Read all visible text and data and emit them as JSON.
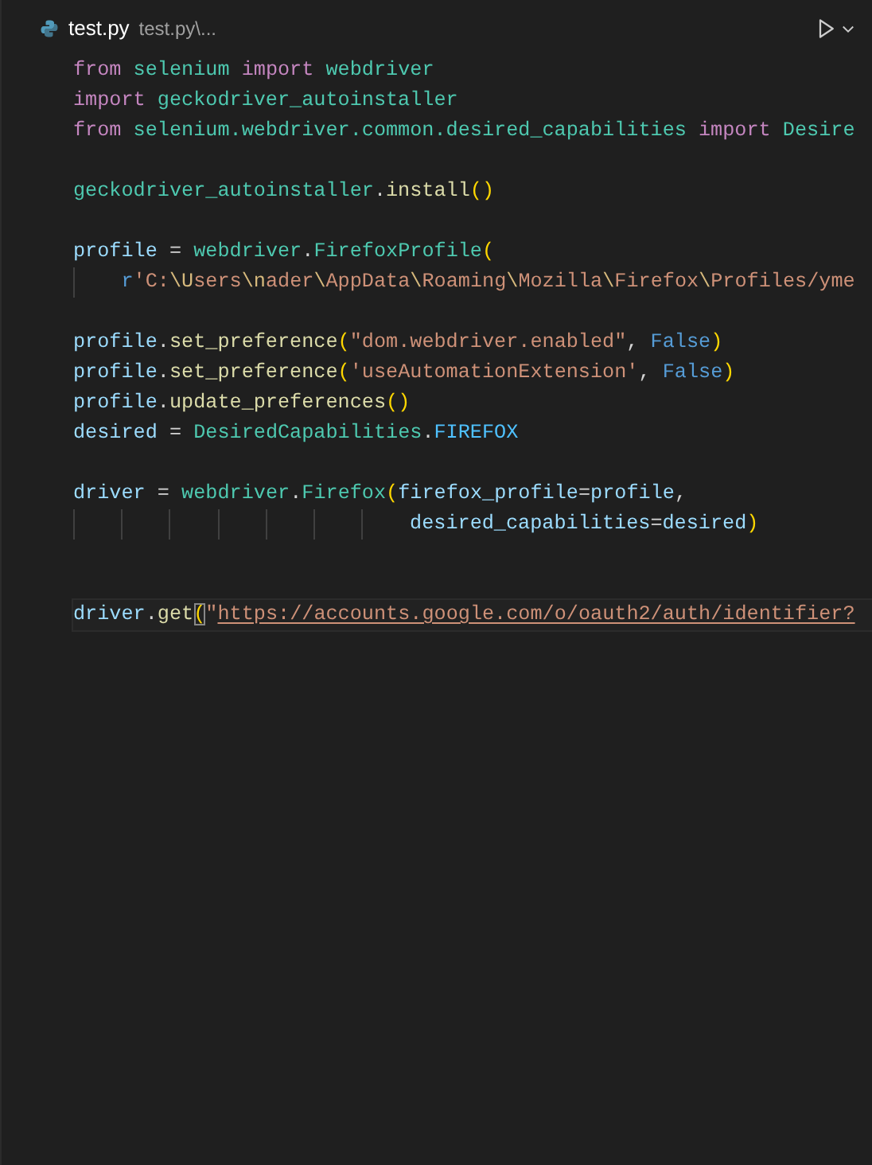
{
  "tab": {
    "title": "test.py",
    "breadcrumb": "test.py\\...",
    "selected": true
  },
  "lines": [
    {
      "kind": "code",
      "tokens": [
        {
          "kind": "kw",
          "text": "from "
        },
        {
          "kind": "mod",
          "text": "selenium "
        },
        {
          "kind": "kw",
          "text": "import "
        },
        {
          "kind": "mod",
          "text": "webdriver"
        }
      ]
    },
    {
      "kind": "code",
      "tokens": [
        {
          "kind": "kw",
          "text": "import "
        },
        {
          "kind": "mod",
          "text": "geckodriver_autoinstaller"
        }
      ]
    },
    {
      "kind": "code",
      "tokens": [
        {
          "kind": "kw",
          "text": "from "
        },
        {
          "kind": "mod",
          "text": "selenium.webdriver.common.desired_capabilities "
        },
        {
          "kind": "kw",
          "text": "import "
        },
        {
          "kind": "mod",
          "text": "Desire"
        }
      ]
    },
    {
      "kind": "blank"
    },
    {
      "kind": "code",
      "tokens": [
        {
          "kind": "mod",
          "text": "geckodriver_autoinstaller"
        },
        {
          "kind": "plain",
          "text": "."
        },
        {
          "kind": "fn",
          "text": "install"
        },
        {
          "kind": "paren",
          "text": "()"
        }
      ]
    },
    {
      "kind": "blank"
    },
    {
      "kind": "code",
      "tokens": [
        {
          "kind": "var",
          "text": "profile"
        },
        {
          "kind": "plain",
          "text": " = "
        },
        {
          "kind": "mod",
          "text": "webdriver"
        },
        {
          "kind": "plain",
          "text": "."
        },
        {
          "kind": "mod",
          "text": "FirefoxProfile"
        },
        {
          "kind": "paren",
          "text": "("
        }
      ]
    },
    {
      "kind": "code",
      "guides": [
        {
          "kind": "guide"
        }
      ],
      "tokens": [
        {
          "kind": "const",
          "text": "r"
        },
        {
          "kind": "str",
          "text": "'C:"
        },
        {
          "kind": "esc",
          "text": "\\U"
        },
        {
          "kind": "str",
          "text": "sers"
        },
        {
          "kind": "esc",
          "text": "\\n"
        },
        {
          "kind": "str",
          "text": "ader"
        },
        {
          "kind": "esc",
          "text": "\\"
        },
        {
          "kind": "str",
          "text": "AppData"
        },
        {
          "kind": "esc",
          "text": "\\"
        },
        {
          "kind": "str",
          "text": "Roaming"
        },
        {
          "kind": "esc",
          "text": "\\"
        },
        {
          "kind": "str",
          "text": "Mozilla"
        },
        {
          "kind": "esc",
          "text": "\\"
        },
        {
          "kind": "str",
          "text": "Firefox"
        },
        {
          "kind": "esc",
          "text": "\\"
        },
        {
          "kind": "str",
          "text": "Profiles/yme"
        }
      ]
    },
    {
      "kind": "blank"
    },
    {
      "kind": "code",
      "tokens": [
        {
          "kind": "var",
          "text": "profile"
        },
        {
          "kind": "plain",
          "text": "."
        },
        {
          "kind": "fn",
          "text": "set_preference"
        },
        {
          "kind": "paren",
          "text": "("
        },
        {
          "kind": "str",
          "text": "\"dom.webdriver.enabled\""
        },
        {
          "kind": "plain",
          "text": ", "
        },
        {
          "kind": "const",
          "text": "False"
        },
        {
          "kind": "paren",
          "text": ")"
        }
      ]
    },
    {
      "kind": "code",
      "tokens": [
        {
          "kind": "var",
          "text": "profile"
        },
        {
          "kind": "plain",
          "text": "."
        },
        {
          "kind": "fn",
          "text": "set_preference"
        },
        {
          "kind": "paren",
          "text": "("
        },
        {
          "kind": "str",
          "text": "'useAutomationExtension'"
        },
        {
          "kind": "plain",
          "text": ", "
        },
        {
          "kind": "const",
          "text": "False"
        },
        {
          "kind": "paren",
          "text": ")"
        }
      ]
    },
    {
      "kind": "code",
      "tokens": [
        {
          "kind": "var",
          "text": "profile"
        },
        {
          "kind": "plain",
          "text": "."
        },
        {
          "kind": "fn",
          "text": "update_preferences"
        },
        {
          "kind": "paren",
          "text": "()"
        }
      ]
    },
    {
      "kind": "code",
      "tokens": [
        {
          "kind": "var",
          "text": "desired"
        },
        {
          "kind": "plain",
          "text": " = "
        },
        {
          "kind": "mod",
          "text": "DesiredCapabilities"
        },
        {
          "kind": "plain",
          "text": "."
        },
        {
          "kind": "constvar",
          "text": "FIREFOX"
        }
      ]
    },
    {
      "kind": "blank"
    },
    {
      "kind": "code",
      "tokens": [
        {
          "kind": "var",
          "text": "driver"
        },
        {
          "kind": "plain",
          "text": " = "
        },
        {
          "kind": "mod",
          "text": "webdriver"
        },
        {
          "kind": "plain",
          "text": "."
        },
        {
          "kind": "mod",
          "text": "Firefox"
        },
        {
          "kind": "paren",
          "text": "("
        },
        {
          "kind": "var",
          "text": "firefox_profile"
        },
        {
          "kind": "plain",
          "text": "="
        },
        {
          "kind": "var",
          "text": "profile"
        },
        {
          "kind": "plain",
          "text": ","
        }
      ]
    },
    {
      "kind": "code",
      "guides": [
        {
          "kind": "guide"
        },
        {
          "kind": "guide"
        },
        {
          "kind": "guide"
        },
        {
          "kind": "guide"
        },
        {
          "kind": "guide"
        },
        {
          "kind": "guide"
        },
        {
          "kind": "guide"
        }
      ],
      "tokens": [
        {
          "kind": "var",
          "text": "desired_capabilities"
        },
        {
          "kind": "plain",
          "text": "="
        },
        {
          "kind": "var",
          "text": "desired"
        },
        {
          "kind": "paren",
          "text": ")"
        }
      ]
    },
    {
      "kind": "blank"
    },
    {
      "kind": "blank"
    },
    {
      "kind": "code",
      "current": true,
      "tokens": [
        {
          "kind": "var",
          "text": "driver"
        },
        {
          "kind": "plain",
          "text": "."
        },
        {
          "kind": "fn",
          "text": "get"
        },
        {
          "kind": "match",
          "text": "("
        },
        {
          "kind": "str",
          "text": "\""
        },
        {
          "kind": "link",
          "text": "https://accounts.google.com/o/oauth2/auth/identifier?"
        }
      ]
    }
  ]
}
